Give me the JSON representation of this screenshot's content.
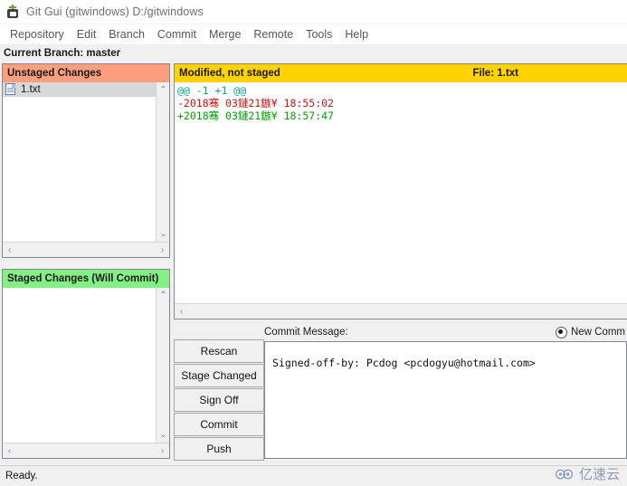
{
  "window": {
    "title": "Git Gui (gitwindows) D:/gitwindows",
    "icon": "git-gui-icon"
  },
  "menubar": {
    "items": [
      {
        "label": "Repository"
      },
      {
        "label": "Edit"
      },
      {
        "label": "Branch"
      },
      {
        "label": "Commit"
      },
      {
        "label": "Merge"
      },
      {
        "label": "Remote"
      },
      {
        "label": "Tools"
      },
      {
        "label": "Help"
      }
    ]
  },
  "branch": {
    "label": "Current Branch: master"
  },
  "unstaged": {
    "header": "Unstaged Changes",
    "header_color": "#fb9f7f",
    "files": [
      {
        "name": "1.txt",
        "icon": "file-text-icon"
      }
    ],
    "scroll_up": "⌃",
    "scroll_down": "⌄",
    "scroll_left": "‹",
    "scroll_right": "›"
  },
  "staged": {
    "header": "Staged Changes (Will Commit)",
    "header_color": "#84ef84",
    "files": [],
    "scroll_up": "⌃",
    "scroll_down": "⌄",
    "scroll_left": "‹",
    "scroll_right": "›"
  },
  "diff": {
    "header_left": "Modified, not staged",
    "header_right": "File:  1.txt",
    "header_color": "#ffd200",
    "lines": [
      {
        "type": "hunk",
        "text": "@@ -1 +1 @@",
        "color": "#00a0a0"
      },
      {
        "type": "del",
        "text": "-2018骞 03鏈21鏃¥ 18:55:02",
        "color": "#cc1111"
      },
      {
        "type": "add",
        "text": "+2018骞 03鏈21鏃¥ 18:57:47",
        "color": "#00a000"
      }
    ],
    "scroll_left": "‹"
  },
  "commit": {
    "label": "Commit Message:",
    "radio_label": "New Comm",
    "radio_selected": true,
    "message": "Signed-off-by: Pcdog <pcdogyu@hotmail.com>"
  },
  "buttons": [
    {
      "label": "Rescan"
    },
    {
      "label": "Stage Changed"
    },
    {
      "label": "Sign Off"
    },
    {
      "label": "Commit"
    },
    {
      "label": "Push"
    }
  ],
  "statusbar": {
    "text": "Ready."
  },
  "watermark": {
    "text": "亿速云",
    "color": "#8b9bb0"
  }
}
